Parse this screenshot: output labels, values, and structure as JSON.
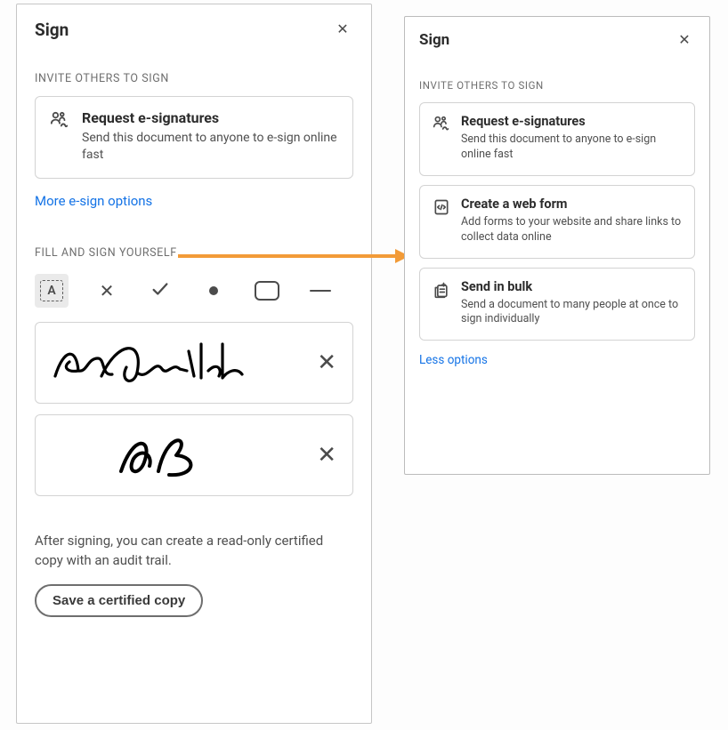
{
  "left": {
    "title": "Sign",
    "section_invite_label": "INVITE OTHERS TO SIGN",
    "card_request": {
      "title": "Request e-signatures",
      "desc": "Send this document to anyone to e-sign online fast"
    },
    "more_link": "More e-sign options",
    "section_fill_label": "FILL AND SIGN YOURSELF",
    "tools": {
      "text_glyph": "A"
    },
    "hint": "After signing, you can create a read-only certified copy with an audit trail.",
    "save_button": "Save a certified copy"
  },
  "right": {
    "title": "Sign",
    "section_invite_label": "INVITE OTHERS TO SIGN",
    "card_request": {
      "title": "Request e-signatures",
      "desc": "Send this document to anyone to e-sign online fast"
    },
    "card_webform": {
      "title": "Create a web form",
      "desc": "Add forms to your website and share links to collect data online"
    },
    "card_bulk": {
      "title": "Send in bulk",
      "desc": "Send a document to many people at once to sign individually"
    },
    "less_link": "Less options"
  }
}
